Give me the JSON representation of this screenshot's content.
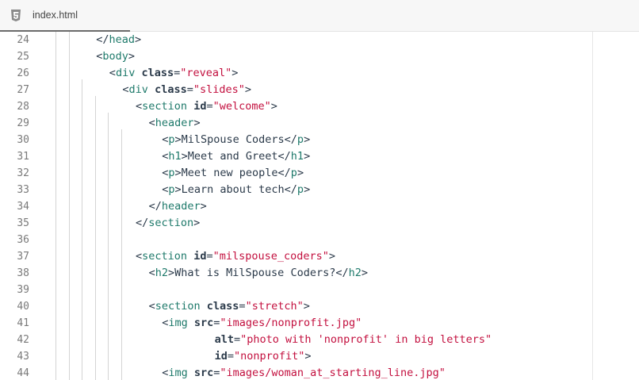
{
  "tab": {
    "label": "index.html",
    "icon": "html5-icon"
  },
  "colors": {
    "tag": "#1f7a6b",
    "attribute": "#2b3a4a",
    "string": "#c3103f",
    "text": "#2b3a4a",
    "line_number": "#7a7a7a"
  },
  "lines": [
    {
      "n": "24",
      "indent": 2,
      "tokens": [
        [
          "b",
          "</"
        ],
        [
          "tag",
          "head"
        ],
        [
          "b",
          ">"
        ]
      ]
    },
    {
      "n": "25",
      "indent": 2,
      "tokens": [
        [
          "b",
          "<"
        ],
        [
          "tag",
          "body"
        ],
        [
          "b",
          ">"
        ]
      ]
    },
    {
      "n": "26",
      "indent": 3,
      "tokens": [
        [
          "b",
          "<"
        ],
        [
          "tag",
          "div"
        ],
        [
          "t",
          " "
        ],
        [
          "attr",
          "class"
        ],
        [
          "b",
          "="
        ],
        [
          "str",
          "\"reveal\""
        ],
        [
          "b",
          ">"
        ]
      ]
    },
    {
      "n": "27",
      "indent": 4,
      "tokens": [
        [
          "b",
          "<"
        ],
        [
          "tag",
          "div"
        ],
        [
          "t",
          " "
        ],
        [
          "attr",
          "class"
        ],
        [
          "b",
          "="
        ],
        [
          "str",
          "\"slides\""
        ],
        [
          "b",
          ">"
        ]
      ]
    },
    {
      "n": "28",
      "indent": 5,
      "tokens": [
        [
          "b",
          "<"
        ],
        [
          "tag",
          "section"
        ],
        [
          "t",
          " "
        ],
        [
          "attr",
          "id"
        ],
        [
          "b",
          "="
        ],
        [
          "str",
          "\"welcome\""
        ],
        [
          "b",
          ">"
        ]
      ]
    },
    {
      "n": "29",
      "indent": 6,
      "tokens": [
        [
          "b",
          "<"
        ],
        [
          "tag",
          "header"
        ],
        [
          "b",
          ">"
        ]
      ]
    },
    {
      "n": "30",
      "indent": 7,
      "tokens": [
        [
          "b",
          "<"
        ],
        [
          "tag",
          "p"
        ],
        [
          "b",
          ">"
        ],
        [
          "t",
          "MilSpouse Coders"
        ],
        [
          "b",
          "</"
        ],
        [
          "tag",
          "p"
        ],
        [
          "b",
          ">"
        ]
      ]
    },
    {
      "n": "31",
      "indent": 7,
      "tokens": [
        [
          "b",
          "<"
        ],
        [
          "tag",
          "h1"
        ],
        [
          "b",
          ">"
        ],
        [
          "t",
          "Meet and Greet"
        ],
        [
          "b",
          "</"
        ],
        [
          "tag",
          "h1"
        ],
        [
          "b",
          ">"
        ]
      ]
    },
    {
      "n": "32",
      "indent": 7,
      "tokens": [
        [
          "b",
          "<"
        ],
        [
          "tag",
          "p"
        ],
        [
          "b",
          ">"
        ],
        [
          "t",
          "Meet new people"
        ],
        [
          "b",
          "</"
        ],
        [
          "tag",
          "p"
        ],
        [
          "b",
          ">"
        ]
      ]
    },
    {
      "n": "33",
      "indent": 7,
      "tokens": [
        [
          "b",
          "<"
        ],
        [
          "tag",
          "p"
        ],
        [
          "b",
          ">"
        ],
        [
          "t",
          "Learn about tech"
        ],
        [
          "b",
          "</"
        ],
        [
          "tag",
          "p"
        ],
        [
          "b",
          ">"
        ]
      ]
    },
    {
      "n": "34",
      "indent": 6,
      "tokens": [
        [
          "b",
          "</"
        ],
        [
          "tag",
          "header"
        ],
        [
          "b",
          ">"
        ]
      ]
    },
    {
      "n": "35",
      "indent": 5,
      "tokens": [
        [
          "b",
          "</"
        ],
        [
          "tag",
          "section"
        ],
        [
          "b",
          ">"
        ]
      ]
    },
    {
      "n": "36",
      "indent": 0,
      "tokens": []
    },
    {
      "n": "37",
      "indent": 5,
      "tokens": [
        [
          "b",
          "<"
        ],
        [
          "tag",
          "section"
        ],
        [
          "t",
          " "
        ],
        [
          "attr",
          "id"
        ],
        [
          "b",
          "="
        ],
        [
          "str",
          "\"milspouse_coders\""
        ],
        [
          "b",
          ">"
        ]
      ]
    },
    {
      "n": "38",
      "indent": 6,
      "tokens": [
        [
          "b",
          "<"
        ],
        [
          "tag",
          "h2"
        ],
        [
          "b",
          ">"
        ],
        [
          "t",
          "What is MilSpouse Coders?"
        ],
        [
          "b",
          "</"
        ],
        [
          "tag",
          "h2"
        ],
        [
          "b",
          ">"
        ]
      ]
    },
    {
      "n": "39",
      "indent": 0,
      "tokens": []
    },
    {
      "n": "40",
      "indent": 6,
      "tokens": [
        [
          "b",
          "<"
        ],
        [
          "tag",
          "section"
        ],
        [
          "t",
          " "
        ],
        [
          "attr",
          "class"
        ],
        [
          "b",
          "="
        ],
        [
          "str",
          "\"stretch\""
        ],
        [
          "b",
          ">"
        ]
      ]
    },
    {
      "n": "41",
      "indent": 7,
      "tokens": [
        [
          "b",
          "<"
        ],
        [
          "tag",
          "img"
        ],
        [
          "t",
          " "
        ],
        [
          "attr",
          "src"
        ],
        [
          "b",
          "="
        ],
        [
          "str",
          "\"images/nonprofit.jpg\""
        ]
      ]
    },
    {
      "n": "42",
      "indent": 11,
      "tokens": [
        [
          "attr",
          "alt"
        ],
        [
          "b",
          "="
        ],
        [
          "str",
          "\"photo with 'nonprofit' in big letters\""
        ]
      ]
    },
    {
      "n": "43",
      "indent": 11,
      "tokens": [
        [
          "attr",
          "id"
        ],
        [
          "b",
          "="
        ],
        [
          "str",
          "\"nonprofit\""
        ],
        [
          "b",
          ">"
        ]
      ]
    },
    {
      "n": "44",
      "indent": 7,
      "tokens": [
        [
          "b",
          "<"
        ],
        [
          "tag",
          "img"
        ],
        [
          "t",
          " "
        ],
        [
          "attr",
          "src"
        ],
        [
          "b",
          "="
        ],
        [
          "str",
          "\"images/woman_at_starting_line.jpg\""
        ]
      ]
    }
  ]
}
